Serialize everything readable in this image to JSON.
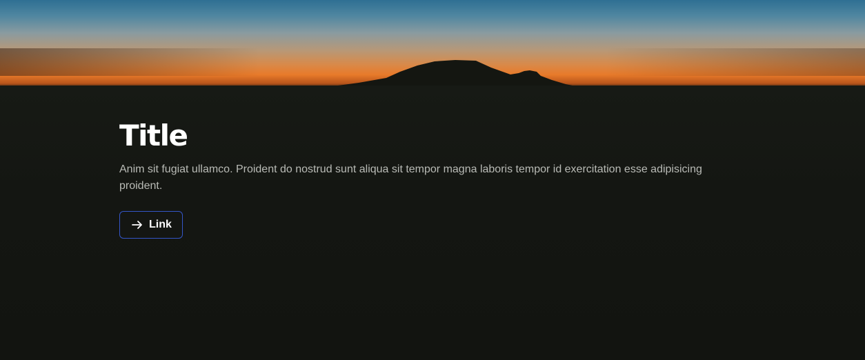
{
  "hero": {
    "title": "Title",
    "description": "Anim sit fugiat ullamco. Proident do nostrud sunt aliqua sit tempor magna laboris tempor id exercitation esse adipisicing proident.",
    "link_label": "Link",
    "link_icon": "arrow-right-icon"
  },
  "colors": {
    "background": "#131511",
    "title": "#ffffff",
    "description": "#b9bbb6",
    "button_border": "#3456c8"
  }
}
